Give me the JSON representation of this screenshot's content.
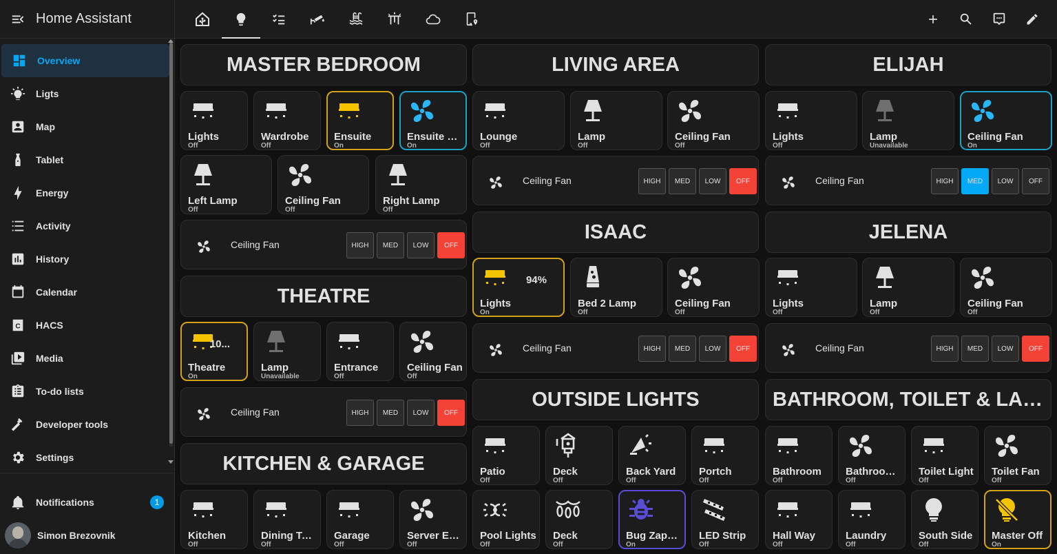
{
  "app": {
    "title": "Home Assistant"
  },
  "sidebar": {
    "items": [
      {
        "label": "Overview",
        "icon": "view-dashboard-icon",
        "selected": true
      },
      {
        "label": "Ligts",
        "icon": "lightbulb-icon"
      },
      {
        "label": "Map",
        "icon": "map-account-icon"
      },
      {
        "label": "Tablet",
        "icon": "tablet-icon"
      },
      {
        "label": "Energy",
        "icon": "lightning-bolt-icon"
      },
      {
        "label": "Activity",
        "icon": "format-list-icon"
      },
      {
        "label": "History",
        "icon": "chart-box-icon"
      },
      {
        "label": "Calendar",
        "icon": "calendar-icon"
      },
      {
        "label": "HACS",
        "icon": "hacs-icon"
      },
      {
        "label": "Media",
        "icon": "play-box-icon"
      },
      {
        "label": "To-do lists",
        "icon": "clipboard-list-icon"
      },
      {
        "label": "Developer tools",
        "icon": "hammer-icon"
      },
      {
        "label": "Settings",
        "icon": "cog-icon"
      }
    ],
    "notifications": {
      "label": "Notifications",
      "count": "1"
    },
    "user": {
      "name": "Simon Brezovnik"
    }
  },
  "topbar": {
    "views": [
      "home-assistant-icon",
      "lightbulb-icon",
      "checklist-icon",
      "cctv-icon",
      "pool-icon",
      "outdoor-lights-icon",
      "cloud-icon",
      "cellphone-marker-icon"
    ],
    "selected_view": 1,
    "actions": [
      "plus-icon",
      "search-icon",
      "assist-icon",
      "pencil-icon"
    ]
  },
  "speed_labels": {
    "high": "HIGH",
    "med": "MED",
    "low": "LOW",
    "off": "OFF"
  },
  "rooms": {
    "master_bedroom": {
      "title": "MASTER BEDROOM",
      "row1": [
        {
          "name": "Lights",
          "state": "Off",
          "icon": "ceiling-light-icon"
        },
        {
          "name": "Wardrobe",
          "state": "Off",
          "icon": "ceiling-light-icon"
        },
        {
          "name": "Ensuite",
          "state": "On",
          "icon": "ceiling-light-icon"
        },
        {
          "name": "Ensuite Fan",
          "state": "On",
          "icon": "fan-icon"
        }
      ],
      "row2": [
        {
          "name": "Left Lamp",
          "state": "Off",
          "icon": "lamp-icon"
        },
        {
          "name": "Ceiling Fan",
          "state": "Off",
          "icon": "fan-icon"
        },
        {
          "name": "Right Lamp",
          "state": "Off",
          "icon": "lamp-icon"
        }
      ],
      "fan": {
        "label": "Ceiling Fan",
        "active": "off"
      }
    },
    "theatre": {
      "title": "THEATRE",
      "row1": [
        {
          "name": "Theatre",
          "state": "On",
          "icon": "ceiling-light-icon",
          "brightness": "10..."
        },
        {
          "name": "Lamp",
          "state": "Unavailable",
          "icon": "lamp-icon"
        },
        {
          "name": "Entrance",
          "state": "Off",
          "icon": "ceiling-light-icon"
        },
        {
          "name": "Ceiling Fan",
          "state": "Off",
          "icon": "fan-icon"
        }
      ],
      "fan": {
        "label": "Ceiling Fan",
        "active": "off"
      }
    },
    "kitchen_garage": {
      "title": "KITCHEN & GARAGE",
      "row1": [
        {
          "name": "Kitchen",
          "state": "Off",
          "icon": "ceiling-light-icon"
        },
        {
          "name": "Dining Table",
          "state": "Off",
          "icon": "ceiling-light-icon"
        },
        {
          "name": "Garage",
          "state": "Off",
          "icon": "ceiling-light-icon"
        },
        {
          "name": "Server Ex Fan",
          "state": "Off",
          "icon": "fan-icon"
        }
      ]
    },
    "living_area": {
      "title": "LIVING AREA",
      "row1": [
        {
          "name": "Lounge",
          "state": "Off",
          "icon": "ceiling-light-icon"
        },
        {
          "name": "Lamp",
          "state": "Off",
          "icon": "lamp-icon"
        },
        {
          "name": "Ceiling Fan",
          "state": "Off",
          "icon": "fan-icon"
        }
      ],
      "fan": {
        "label": "Ceiling Fan",
        "active": "off"
      }
    },
    "isaac": {
      "title": "ISAAC",
      "row1": [
        {
          "name": "Lights",
          "state": "On",
          "icon": "ceiling-light-icon",
          "brightness": "94%"
        },
        {
          "name": "Bed 2 Lamp",
          "state": "Off",
          "icon": "lava-lamp-icon"
        },
        {
          "name": "Ceiling Fan",
          "state": "Off",
          "icon": "fan-icon"
        }
      ],
      "fan": {
        "label": "Ceiling Fan",
        "active": "off"
      }
    },
    "outside_lights": {
      "title": "OUTSIDE LIGHTS",
      "row1": [
        {
          "name": "Patio",
          "state": "Off",
          "icon": "ceiling-light-icon"
        },
        {
          "name": "Deck",
          "state": "Off",
          "icon": "outdoor-lamp-icon"
        },
        {
          "name": "Back Yard",
          "state": "Off",
          "icon": "spotlight-icon"
        },
        {
          "name": "Portch",
          "state": "Off",
          "icon": "ceiling-light-icon"
        }
      ],
      "row2": [
        {
          "name": "Pool Lights",
          "state": "Off",
          "icon": "pool-light-icon"
        },
        {
          "name": "Deck",
          "state": "Off",
          "icon": "string-lights-icon"
        },
        {
          "name": "Bug Zapper",
          "state": "On",
          "icon": "bug-icon"
        },
        {
          "name": "LED Strip",
          "state": "Off",
          "icon": "led-strip-icon"
        }
      ]
    },
    "elijah": {
      "title": "ELIJAH",
      "row1": [
        {
          "name": "Lights",
          "state": "Off",
          "icon": "ceiling-light-icon"
        },
        {
          "name": "Lamp",
          "state": "Unavailable",
          "icon": "lamp-icon"
        },
        {
          "name": "Ceiling Fan",
          "state": "On",
          "icon": "fan-icon"
        }
      ],
      "fan": {
        "label": "Ceiling Fan",
        "active": "med"
      }
    },
    "jelena": {
      "title": "JELENA",
      "row1": [
        {
          "name": "Lights",
          "state": "Off",
          "icon": "ceiling-light-icon"
        },
        {
          "name": "Lamp",
          "state": "Off",
          "icon": "lamp-icon"
        },
        {
          "name": "Ceiling Fan",
          "state": "Off",
          "icon": "fan-icon"
        }
      ],
      "fan": {
        "label": "Ceiling Fan",
        "active": "off"
      }
    },
    "bathroom": {
      "title": "BATHROOM, TOILET & LAUNDRY",
      "row1": [
        {
          "name": "Bathroom",
          "state": "Off",
          "icon": "ceiling-light-icon"
        },
        {
          "name": "Bathroom Exhaust Fan",
          "state": "Off",
          "icon": "fan-icon"
        },
        {
          "name": "Toilet Light",
          "state": "Off",
          "icon": "ceiling-light-icon"
        },
        {
          "name": "Toilet Fan",
          "state": "Off",
          "icon": "fan-icon"
        }
      ],
      "row2": [
        {
          "name": "Hall Way",
          "state": "Off",
          "icon": "ceiling-light-icon"
        },
        {
          "name": "Laundry",
          "state": "Off",
          "icon": "ceiling-light-icon"
        },
        {
          "name": "South Side",
          "state": "Off",
          "icon": "lightbulb-icon"
        },
        {
          "name": "Master Off",
          "state": "On",
          "icon": "lightbulb-off-icon"
        }
      ]
    }
  },
  "colors": {
    "on_yellow": "#f5c400",
    "on_cyan": "#29b6f6",
    "on_purple": "#5b4cd6",
    "off_red": "#f44336",
    "unavailable": "#6f6f6f"
  }
}
